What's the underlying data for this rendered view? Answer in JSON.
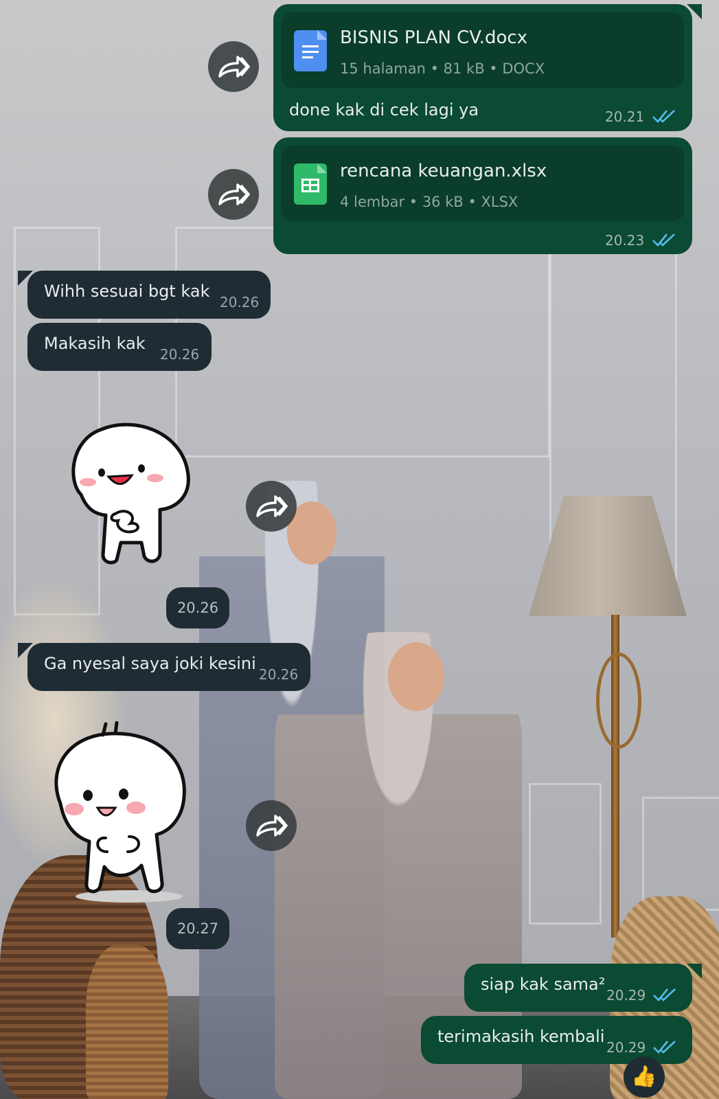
{
  "messages": [
    {
      "type": "document",
      "direction": "outgoing",
      "file_name": "BISNIS PLAN CV.docx",
      "meta": "15 halaman • 81 kB • DOCX",
      "file_icon": "docx-icon",
      "caption": "done kak di cek lagi ya",
      "time": "20.21",
      "status": "read"
    },
    {
      "type": "document",
      "direction": "outgoing",
      "file_name": "rencana keuangan.xlsx",
      "meta": "4 lembar • 36 kB • XLSX",
      "file_icon": "xlsx-icon",
      "time": "20.23",
      "status": "read"
    },
    {
      "type": "text",
      "direction": "incoming",
      "text": "Wihh sesuai bgt kak",
      "time": "20.26"
    },
    {
      "type": "text",
      "direction": "incoming",
      "text": "Makasih kak",
      "time": "20.26"
    },
    {
      "type": "sticker",
      "direction": "incoming",
      "sticker": "happy-bun-sticker",
      "time": "20.26"
    },
    {
      "type": "text",
      "direction": "incoming",
      "text": "Ga nyesal saya joki kesini",
      "time": "20.26"
    },
    {
      "type": "sticker",
      "direction": "incoming",
      "sticker": "excited-bun-sticker",
      "time": "20.27"
    },
    {
      "type": "text",
      "direction": "outgoing",
      "text": "siap kak sama²",
      "time": "20.29",
      "status": "read"
    },
    {
      "type": "text",
      "direction": "outgoing",
      "text": "terimakasih kembali",
      "time": "20.29",
      "status": "read"
    }
  ],
  "reaction": "👍",
  "colors": {
    "outgoing_bubble": "#0b4a33",
    "incoming_bubble": "#1f2c33",
    "read_ticks": "#53bdeb",
    "forward_button": "#373c3e"
  }
}
